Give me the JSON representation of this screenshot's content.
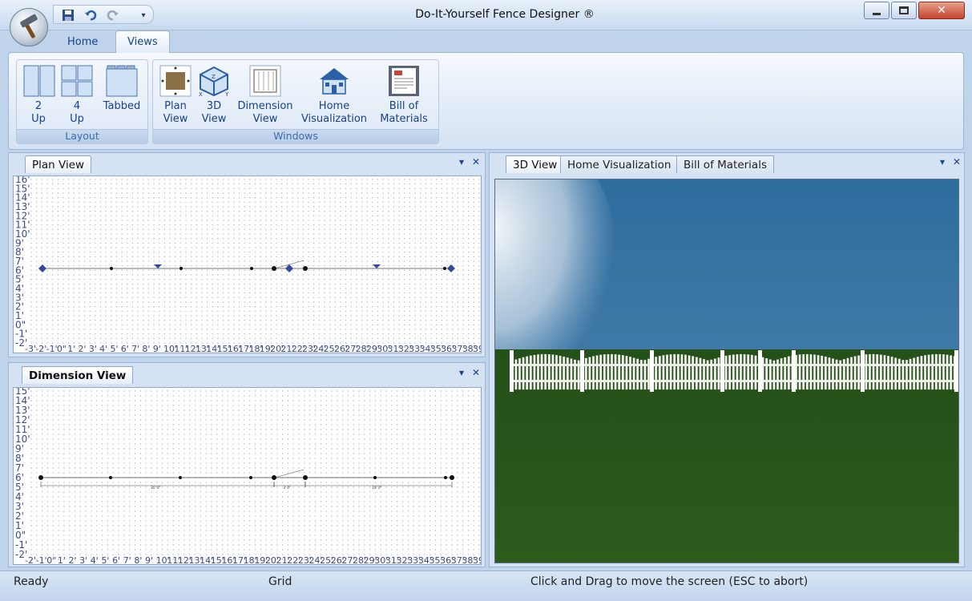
{
  "window": {
    "title": "Do-It-Yourself Fence Designer ®",
    "qat": [
      "save-icon",
      "undo-icon",
      "redo-icon",
      "customize-dropdown-icon"
    ],
    "controls": [
      "minimize-icon",
      "maximize-icon",
      "close-icon"
    ]
  },
  "ribbon": {
    "tabs": [
      "Home",
      "Views"
    ],
    "active_tab": "Views",
    "groups": [
      {
        "label": "Layout",
        "buttons": [
          {
            "line1": "2",
            "line2": "Up"
          },
          {
            "line1": "4",
            "line2": "Up"
          },
          {
            "line1": "Tabbed",
            "line2": ""
          }
        ]
      },
      {
        "label": "Windows",
        "buttons": [
          {
            "line1": "Plan",
            "line2": "View"
          },
          {
            "line1": "3D",
            "line2": "View"
          },
          {
            "line1": "Dimension",
            "line2": "View"
          },
          {
            "line1": "Home",
            "line2": "Visualization"
          },
          {
            "line1": "Bill of",
            "line2": "Materials"
          }
        ]
      }
    ],
    "icon_3d_axes": [
      "Z",
      "X",
      "Y"
    ]
  },
  "plan_panel": {
    "tab": "Plan View",
    "controls": [
      "▾",
      "✕"
    ]
  },
  "dimension_panel": {
    "tab": "Dimension View",
    "controls": [
      "▾",
      "✕"
    ]
  },
  "view3d_panel": {
    "tabs": [
      "3D View",
      "Home Visualization",
      "Bill of Materials"
    ],
    "active": "3D View",
    "controls": [
      "▾",
      "✕"
    ]
  },
  "plan_grid": {
    "y_labels": [
      "16'",
      "15'",
      "14'",
      "13'",
      "12'",
      "11'",
      "10'",
      "9'",
      "8'",
      "7'",
      "6'",
      "5'",
      "4'",
      "3'",
      "2'",
      "1'",
      "0\"",
      "-1'",
      "-2'"
    ],
    "x_labels": [
      "-3'",
      "-2'",
      "-1'",
      "0\"",
      "1'",
      "2'",
      "3'",
      "4'",
      "5'",
      "6'",
      "7'",
      "8'",
      "9'",
      "10'",
      "11'",
      "12'",
      "13'",
      "14'",
      "15'",
      "16'",
      "17'",
      "18'",
      "19'",
      "20'",
      "21'",
      "22'",
      "23'",
      "24'",
      "25'",
      "26'",
      "27'",
      "28'",
      "29'",
      "30'",
      "31'",
      "32'",
      "33'",
      "34'",
      "35'",
      "36'",
      "37'",
      "38'",
      "39'"
    ]
  },
  "dimension_grid": {
    "y_labels": [
      "15'",
      "14'",
      "13'",
      "12'",
      "11'",
      "10'",
      "9'",
      "8'",
      "7'",
      "6'",
      "5'",
      "4'",
      "3'",
      "2'",
      "1'",
      "0\"",
      "-1'",
      "-2'"
    ],
    "x_labels": [
      "-2'",
      "-1'",
      "0\"",
      "1'",
      "2'",
      "3'",
      "4'",
      "5'",
      "6'",
      "7'",
      "8'",
      "9'",
      "10'",
      "11'",
      "12'",
      "13'",
      "14'",
      "15'",
      "16'",
      "17'",
      "18'",
      "19'",
      "20'",
      "21'",
      "22'",
      "23'",
      "24'",
      "25'",
      "26'",
      "27'",
      "28'",
      "29'",
      "30'",
      "31'",
      "32'",
      "33'",
      "34'",
      "35'",
      "36'",
      "37'",
      "38'",
      "39'"
    ],
    "measurements": [
      "20' 0\"",
      "3' 0\"",
      "10' 0\""
    ]
  },
  "colors": {
    "sky": "#3f79a6",
    "grass": "#2e5a1c",
    "fence": "#f2f2ee",
    "ribbon": "#dfe9f5"
  },
  "status": {
    "ready": "Ready",
    "grid": "Grid",
    "hint": "Click and Drag to move the screen  (ESC to abort)"
  }
}
